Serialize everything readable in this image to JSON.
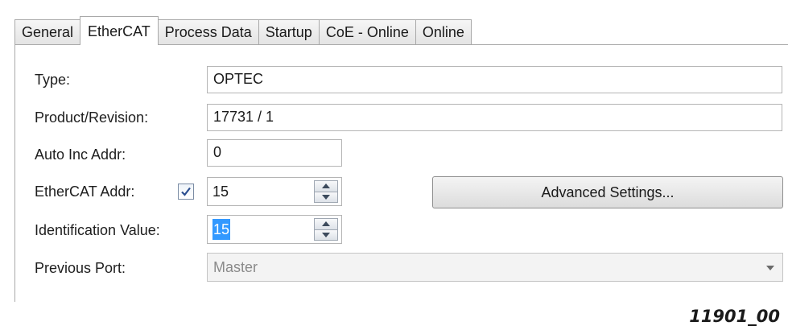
{
  "tabs": [
    {
      "label": "General"
    },
    {
      "label": "EtherCAT"
    },
    {
      "label": "Process Data"
    },
    {
      "label": "Startup"
    },
    {
      "label": "CoE - Online"
    },
    {
      "label": "Online"
    }
  ],
  "active_tab": "EtherCAT",
  "form": {
    "type": {
      "label": "Type:",
      "value": "OPTEC"
    },
    "product_revision": {
      "label": "Product/Revision:",
      "value": "17731 / 1"
    },
    "auto_inc_addr": {
      "label": "Auto Inc Addr:",
      "value": "0"
    },
    "ethercat_addr": {
      "label": "EtherCAT Addr:",
      "checked": true,
      "value": "15"
    },
    "identification_value": {
      "label": "Identification Value:",
      "value": "15",
      "selected": true
    },
    "previous_port": {
      "label": "Previous Port:",
      "value": "Master",
      "disabled": true
    }
  },
  "advanced_settings_label": "Advanced Settings...",
  "figure_id": "11901_00",
  "colors": {
    "selection": "#3399ff",
    "checkmark": "#2a4d8f"
  },
  "icons": {
    "spin_up": "up-arrow-icon",
    "spin_down": "down-arrow-icon",
    "dropdown": "chevron-down-icon",
    "check": "checkmark-icon"
  }
}
